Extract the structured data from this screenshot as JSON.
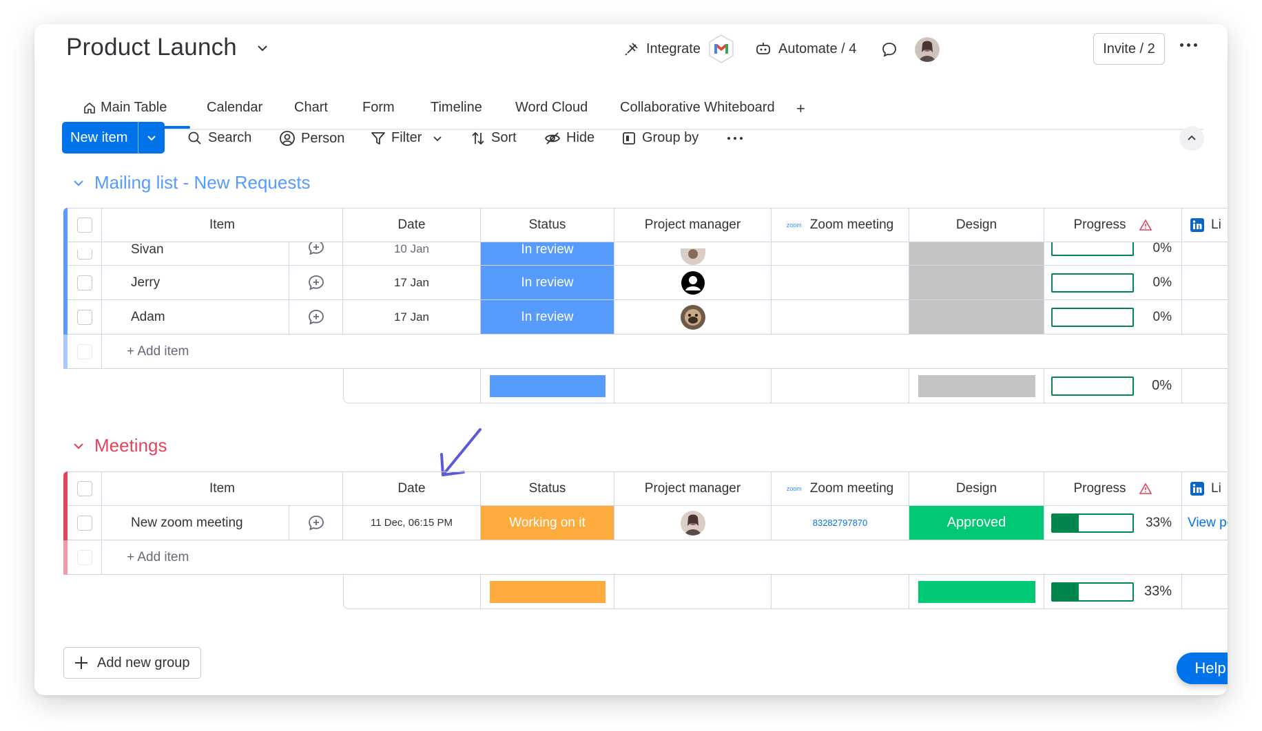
{
  "header": {
    "title": "Product Launch",
    "integrate_label": "Integrate",
    "automate_label": "Automate / 4",
    "invite_label": "Invite / 2"
  },
  "tabs": [
    {
      "label": "Main Table"
    },
    {
      "label": "Calendar"
    },
    {
      "label": "Chart"
    },
    {
      "label": "Form"
    },
    {
      "label": "Timeline"
    },
    {
      "label": "Word Cloud"
    },
    {
      "label": "Collaborative Whiteboard"
    },
    {
      "label": "+"
    }
  ],
  "toolbar": {
    "new_item_label": "New item",
    "search_label": "Search",
    "person_label": "Person",
    "filter_label": "Filter",
    "sort_label": "Sort",
    "hide_label": "Hide",
    "group_by_label": "Group by"
  },
  "columns": {
    "item": "Item",
    "date": "Date",
    "status": "Status",
    "project_manager": "Project manager",
    "zoom": "Zoom meeting",
    "zoom_logo": "zoom",
    "design": "Design",
    "progress": "Progress",
    "linkedin": "Li"
  },
  "groups": [
    {
      "title": "Mailing list - New Requests",
      "color": "#579bfc",
      "rows": [
        {
          "item": "Sivan",
          "date": "10 Jan",
          "status": "In review",
          "status_color": "#579bfc",
          "progress": "0%",
          "progress_value": 0
        },
        {
          "item": "Jerry",
          "date": "17 Jan",
          "status": "In review",
          "status_color": "#579bfc",
          "progress": "0%",
          "progress_value": 0
        },
        {
          "item": "Adam",
          "date": "17 Jan",
          "status": "In review",
          "status_color": "#579bfc",
          "progress": "0%",
          "progress_value": 0
        }
      ],
      "add_item": "+ Add item",
      "summary_progress": "0%"
    },
    {
      "title": "Meetings",
      "color": "#e2445c",
      "rows": [
        {
          "item": "New zoom meeting",
          "date": "11 Dec, 06:15 PM",
          "status": "Working on it",
          "status_color": "#fdab3d",
          "zoom": "83282797870",
          "design": "Approved",
          "design_color": "#00c875",
          "progress": "33%",
          "progress_value": 33,
          "linkedin": "View po"
        }
      ],
      "add_item": "+ Add item",
      "summary_progress": "33%"
    }
  ],
  "footer": {
    "add_group_label": "Add new group",
    "help_label": "Help"
  },
  "colors": {
    "primary": "#0073ea",
    "in_review": "#579bfc",
    "working": "#fdab3d",
    "approved": "#00c875",
    "design_empty": "#c4c4c4",
    "progress_green": "#00854d"
  }
}
